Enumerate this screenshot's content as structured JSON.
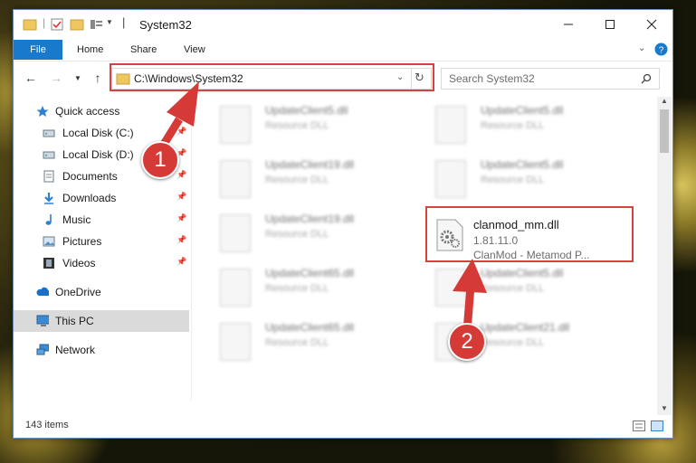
{
  "window": {
    "title": "System32"
  },
  "ribbon": {
    "tabs": [
      "File",
      "Home",
      "Share",
      "View"
    ]
  },
  "address": {
    "path": "C:\\Windows\\System32",
    "search_placeholder": "Search System32"
  },
  "sidebar": {
    "items": [
      {
        "label": "Quick access",
        "icon": "star-icon"
      },
      {
        "label": "Local Disk (C:)",
        "icon": "drive-icon"
      },
      {
        "label": "Local Disk (D:)",
        "icon": "drive-icon"
      },
      {
        "label": "Documents",
        "icon": "documents-icon"
      },
      {
        "label": "Downloads",
        "icon": "download-icon"
      },
      {
        "label": "Music",
        "icon": "music-icon"
      },
      {
        "label": "Pictures",
        "icon": "pictures-icon"
      },
      {
        "label": "Videos",
        "icon": "videos-icon"
      },
      {
        "label": "OneDrive",
        "icon": "cloud-icon"
      },
      {
        "label": "This PC",
        "icon": "computer-icon"
      },
      {
        "label": "Network",
        "icon": "network-icon"
      }
    ]
  },
  "files": {
    "blurred": [
      {
        "name": "UpdateClient5.dll",
        "sub": "Resource DLL"
      },
      {
        "name": "UpdateClient5.dll",
        "sub": "Resource DLL"
      },
      {
        "name": "UpdateClient19.dll",
        "sub": "Resource DLL"
      },
      {
        "name": "UpdateClient5.dll",
        "sub": "Resource DLL"
      },
      {
        "name": "UpdateClient19.dll",
        "sub": "Resource DLL"
      },
      {
        "name": "UpdateClient65.dll",
        "sub": "Resource DLL"
      },
      {
        "name": "UpdateClient5.dll",
        "sub": "Resource DLL"
      },
      {
        "name": "UpdateClient65.dll",
        "sub": "Resource DLL"
      },
      {
        "name": "UpdateClient21.dll",
        "sub": "Resource DLL"
      }
    ],
    "highlighted": {
      "name": "clanmod_mm.dll",
      "version": "1.81.11.0",
      "description": "ClanMod - Metamod P..."
    }
  },
  "status": {
    "items_count": "143 items"
  },
  "annotations": {
    "step1": "1",
    "step2": "2",
    "color": "#d63a36"
  }
}
